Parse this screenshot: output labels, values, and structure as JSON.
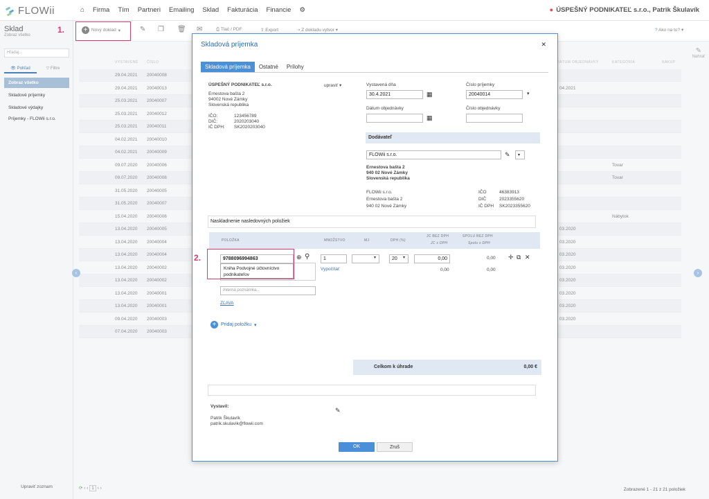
{
  "app": {
    "logo": "FLOWii",
    "nav": [
      "Firma",
      "Tím",
      "Partneri",
      "Emailing",
      "Sklad",
      "Fakturácia",
      "Financie"
    ],
    "company": "ÚSPEŠNÝ PODNIKATEĽ s.r.o., Patrik Škulavík",
    "help": "Ako na to?",
    "edit_label": "Nahrať"
  },
  "sidebar": {
    "title": "Sklad",
    "subtitle": "Zobraz všetko",
    "search_placeholder": "Hľadaj...",
    "tabs": [
      "Pohľad",
      "Filtre"
    ],
    "items": [
      "Zobraz všetko",
      "Skladové príjemky",
      "Skladové výdajky",
      "Príjemky - FLOWii s.r.o."
    ],
    "footer": "Upraviť zoznam"
  },
  "toolbar": {
    "new_doc": "Nový doklad",
    "print": "Tlač / PDF",
    "export": "Export",
    "from_doc": "Z dokladu vytvor"
  },
  "steps": {
    "one": "1.",
    "two": "2."
  },
  "grid": {
    "headers": [
      "VYSTAVENÉ",
      "ČÍSLO",
      "DÁTUM OBJEDNÁVKY",
      "KATEGÓRIA",
      "NÁKUP"
    ],
    "rows": [
      {
        "date": "29.04.2021",
        "num": "20040008",
        "tag": ""
      },
      {
        "date": "29.04.2021",
        "num": "20040013",
        "tag": ""
      },
      {
        "date": "25.03.2021",
        "num": "20040007",
        "tag": ""
      },
      {
        "date": "25.03.2021",
        "num": "20040012",
        "tag": ""
      },
      {
        "date": "25.03.2021",
        "num": "20040011",
        "tag": ""
      },
      {
        "date": "04.02.2021",
        "num": "20040010",
        "tag": ""
      },
      {
        "date": "04.02.2021",
        "num": "20040009",
        "tag": ""
      },
      {
        "date": "09.07.2020",
        "num": "20040006",
        "tag": "Tovar"
      },
      {
        "date": "09.07.2020",
        "num": "20040008",
        "tag": "Tovar"
      },
      {
        "date": "31.05.2020",
        "num": "20040005",
        "tag": ""
      },
      {
        "date": "31.05.2020",
        "num": "20040007",
        "tag": ""
      },
      {
        "date": "15.04.2020",
        "num": "20040006",
        "tag": "Nábytok"
      },
      {
        "date": "13.04.2020",
        "num": "20040005",
        "tag": ""
      },
      {
        "date": "13.04.2020",
        "num": "20040004",
        "tag": ""
      },
      {
        "date": "13.04.2020",
        "num": "20040004",
        "tag": ""
      },
      {
        "date": "13.04.2020",
        "num": "20040002",
        "tag": ""
      },
      {
        "date": "13.04.2020",
        "num": "20040002",
        "tag": ""
      },
      {
        "date": "13.04.2020",
        "num": "20040001",
        "tag": ""
      },
      {
        "date": "13.04.2020",
        "num": "20040001",
        "tag": ""
      },
      {
        "date": "09.04.2020",
        "num": "20040003",
        "tag": ""
      },
      {
        "date": "07.04.2020",
        "num": "20040003",
        "tag": ""
      }
    ],
    "right_dates": [
      "04.2021",
      "03.2020",
      "03.2020",
      "03.2020",
      "03.2020",
      "03.2020",
      "03.2020",
      "03.2020",
      "03.2020"
    ],
    "pager_info": "Zobrazené 1 - 21 z 21 položiek",
    "page": "1"
  },
  "modal": {
    "title": "Skladová príjemka",
    "tabs": [
      "Skladová príjemka",
      "Ostatné",
      "Prílohy"
    ],
    "company": {
      "name": "ÚSPEŠNÝ PODNIKATEĽ s.r.o.",
      "street": "Ernestova bašta 2",
      "city": "94002 Nové Zámky",
      "country": "Slovenská republika",
      "ico_label": "IČO:",
      "ico": "123456789",
      "dic_label": "DIČ:",
      "dic": "2020203040",
      "icdph_label": "IČ DPH:",
      "icdph": "SK2020203040",
      "edit": "upraviť"
    },
    "issued_label": "Vystavená dňa",
    "issued": "30.4.2021",
    "number_label": "Číslo príjemky",
    "number": "20040014",
    "order_date_label": "Dátum objednávky",
    "order_num_label": "Číslo objednávky",
    "supplier": {
      "header": "Dodávateľ",
      "name": "FLOWii s.r.o.",
      "street": "Ernestova bašta 2",
      "city": "940 02 Nové Zámky",
      "country": "Slovenská republika",
      "line1": "FLOWii s.r.o.",
      "line2": "Ernestova bašta 2",
      "line3": "940 02 Nové Zámky",
      "ico_label": "IČO",
      "ico": "46383913",
      "dic_label": "DIČ",
      "dic": "2023355620",
      "icdph_label": "IČ DPH",
      "icdph": "SK2023355620"
    },
    "note": "Naskladnenie nasledovných položiek",
    "items_head": {
      "item": "POLOŽKA",
      "qty": "MNOŽSTVO",
      "mj": "MJ",
      "vat": "DPH (%)",
      "unit": "JC BEZ DPH",
      "unit2": "JC s DPH",
      "sum": "SPOLU BEZ DPH",
      "sum2": "Spolu s DPH"
    },
    "row": {
      "code": "9788096994863",
      "name": "Kniha Podvojné účtovníctvo podnikateľov",
      "qty": "1",
      "vat": "20",
      "price": "0,00",
      "total": "0,00",
      "total2": "0,00",
      "price2": "0,00",
      "calc": "Vypočítať",
      "internal_note": "Interná poznámka...",
      "discount": "ZĽAVA"
    },
    "add_item": "Pridaj položku",
    "total_label": "Celkom k úhrade",
    "total": "0,00 €",
    "issuer_label": "Vystavil:",
    "issuer_name": "Patrik Škulavík",
    "issuer_email": "patrik.skulavik@flowii.com",
    "ok": "OK",
    "cancel": "Zruš"
  }
}
